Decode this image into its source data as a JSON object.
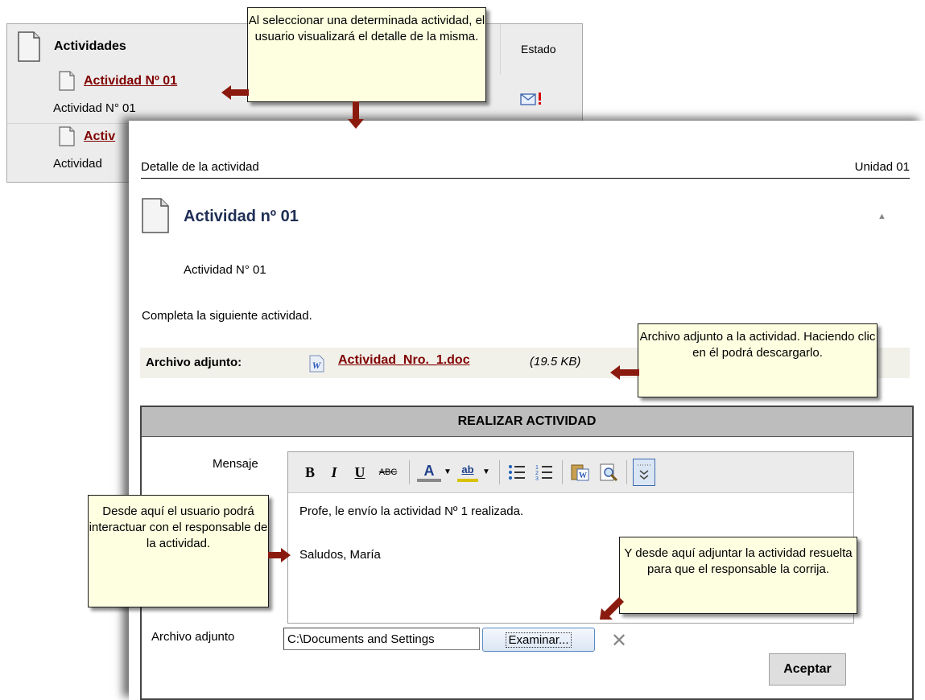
{
  "activity_list": {
    "title": "Actividades",
    "estado_label": "Estado",
    "items": [
      {
        "link": "Actividad Nº 01",
        "subtitle": "Actividad N° 01"
      },
      {
        "link": "Activ",
        "subtitle": "Actividad"
      }
    ]
  },
  "detail": {
    "header_label": "Detalle de la actividad",
    "unit": "Unidad 01",
    "title": "Actividad nº 01",
    "subtitle": "Actividad N° 01",
    "description": "Completa la siguiente actividad.",
    "attachment": {
      "label": "Archivo adjunto:",
      "file_name": "Actividad_Nro._1.doc",
      "file_size": "(19.5 KB)"
    }
  },
  "realizar": {
    "title": "REALIZAR ACTIVIDAD",
    "mensaje_label": "Mensaje",
    "toolbar": {
      "bold": "B",
      "italic": "I",
      "underline": "U",
      "strike": "ABC",
      "font_color": "A",
      "highlight": "ab"
    },
    "message_lines": [
      "Profe, le envío la actividad Nº 1 realizada.",
      "Saludos, María"
    ],
    "archivo_label": "Archivo adjunto",
    "file_value": "C:\\Documents and Settings",
    "examinar_label": "Examinar...",
    "aceptar_label": "Aceptar"
  },
  "callouts": {
    "select_activity": "Al seleccionar una determinada actividad, el usuario visualizará el detalle  de la misma.",
    "attachment": "Archivo adjunto a la actividad. Haciendo clic en él podrá descargarlo.",
    "interact": "Desde aquí el usuario podrá interactuar con el responsable de la actividad.",
    "upload": "Y desde aquí adjuntar la actividad resuelta para que el responsable la corrija."
  },
  "colors": {
    "link": "#800000",
    "title_blue": "#1f2f55",
    "callout_bg": "#fdffe0",
    "arrow": "#8b1a0e"
  },
  "icons": [
    "document-icon",
    "email-alert-icon",
    "word-doc-icon",
    "collapse-arrow-icon",
    "remove-icon",
    "bullet-list-icon",
    "numbered-list-icon",
    "paste-word-icon",
    "preview-icon",
    "more-tools-icon"
  ]
}
